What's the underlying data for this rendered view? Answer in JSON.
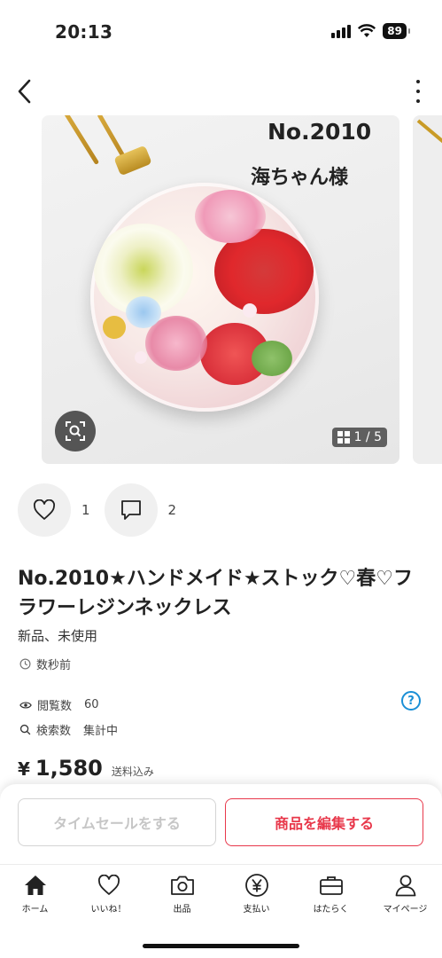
{
  "status_bar": {
    "time": "20:13",
    "battery": "89"
  },
  "product_image": {
    "overlay_line1": "No.2010",
    "overlay_line2": "海ちゃん様",
    "counter": "1 / 5"
  },
  "reactions": {
    "likes": "1",
    "comments": "2"
  },
  "product": {
    "title": "No.2010★ハンドメイド★ストック♡春♡フラワーレジンネックレス",
    "condition": "新品、未使用",
    "posted": "数秒前",
    "views_label": "閲覧数",
    "views_value": "60",
    "search_label": "検索数",
    "search_value": "集計中",
    "price_yen": "¥",
    "price_value": "1,580",
    "shipping": "送料込み"
  },
  "actions": {
    "timesale": "タイムセールをする",
    "edit": "商品を編集する"
  },
  "tabbar": {
    "home": "ホーム",
    "likes": "いいね！",
    "sell": "出品",
    "pay": "支払い",
    "work": "はたらく",
    "mypage": "マイページ"
  },
  "colors": {
    "accent": "#e8384b",
    "help": "#1a8fd6"
  },
  "icons": [
    "back-icon",
    "more-icon",
    "lens-search-icon",
    "grid-icon",
    "heart-icon",
    "comment-icon",
    "clock-icon",
    "eye-icon",
    "search-icon",
    "help-icon",
    "home-icon",
    "camera-icon",
    "yen-icon",
    "briefcase-icon",
    "person-icon"
  ]
}
